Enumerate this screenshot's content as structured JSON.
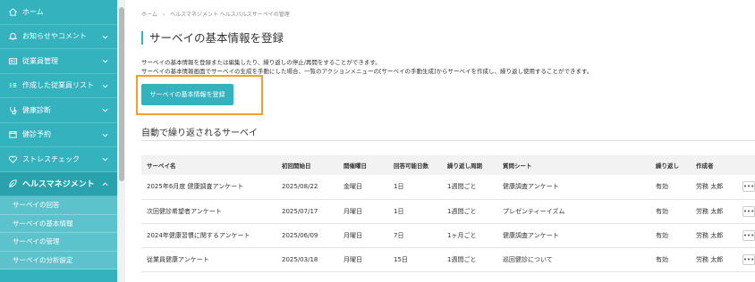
{
  "sidebar": {
    "items": [
      {
        "label": "ホーム",
        "icon": "home-icon",
        "chevron": false
      },
      {
        "label": "お知らせやコメント",
        "icon": "bell-icon",
        "chevron": true
      },
      {
        "label": "従業員管理",
        "icon": "id-card-icon",
        "chevron": true
      },
      {
        "label": "作成した従業員リスト",
        "icon": "people-list-icon",
        "chevron": true
      },
      {
        "label": "健康診断",
        "icon": "stethoscope-icon",
        "chevron": true
      },
      {
        "label": "健診予約",
        "icon": "calendar-icon",
        "chevron": true
      },
      {
        "label": "ストレスチェック",
        "icon": "heart-icon",
        "chevron": true
      },
      {
        "label": "ヘルスマネジメント",
        "icon": "leaf-icon",
        "chevron": true
      }
    ],
    "sub_items": [
      "サーベイの回答",
      "サーベイの基本情報",
      "サーベイの管理",
      "サーベイの分析設定"
    ]
  },
  "breadcrumb": [
    "ホーム",
    "›",
    "ヘルスマネジメント ヘルスパルスサーベイの管理"
  ],
  "page_title": "サーベイの基本情報を登録",
  "description": [
    "サーベイの基本情報を登録または編集したり、繰り返しの停止/再開をすることができます。",
    "サーベイの基本情報画面でサーベイの生成を手動にした場合、一覧のアクションメニューの[サーベイの手動生成]からサーベイを作成し、繰り返し使用することができます。"
  ],
  "register_button": "サーベイの基本情報を登録",
  "section_title": "自動で繰り返されるサーベイ",
  "table": {
    "headers": [
      "サーベイ名",
      "初回開始日",
      "開催曜日",
      "回答可能日数",
      "繰り返し周期",
      "質問シート",
      "繰り返し",
      "作成者"
    ],
    "rows": [
      {
        "name": "2025年6月度 健康調査アンケート",
        "start": "2025/08/22",
        "weekday": "金曜日",
        "days": "1日",
        "cycle": "1週間ごと",
        "sheet": "健康調査アンケート",
        "repeat": "有効",
        "author": "労務 太郎",
        "sheet_color": "#2a7bd4"
      },
      {
        "name": "次回健診希望者アンケート",
        "start": "2025/07/17",
        "weekday": "月曜日",
        "days": "1日",
        "cycle": "1週間ごと",
        "sheet": "プレゼンティーイズム",
        "repeat": "有効",
        "author": "労務 太郎",
        "sheet_color": "#7b2fd0"
      },
      {
        "name": "2024年健康習慣に関するアンケート",
        "start": "2025/06/09",
        "weekday": "月曜日",
        "days": "7日",
        "cycle": "1ヶ月ごと",
        "sheet": "健康調査アンケート",
        "repeat": "有効",
        "author": "労務 太郎",
        "sheet_color": "#2a7bd4"
      },
      {
        "name": "従業員健康アンケート",
        "start": "2025/03/18",
        "weekday": "月曜日",
        "days": "15日",
        "cycle": "1週間ごと",
        "sheet": "巡回健診について",
        "repeat": "有効",
        "author": "労務 太郎",
        "sheet_color": "#2a7bd4"
      }
    ],
    "more_label": "•••"
  },
  "colors": {
    "accent": "#34b2be",
    "highlight": "#f0a030",
    "link": "#2a7bd4",
    "status": "#5cb85c"
  }
}
